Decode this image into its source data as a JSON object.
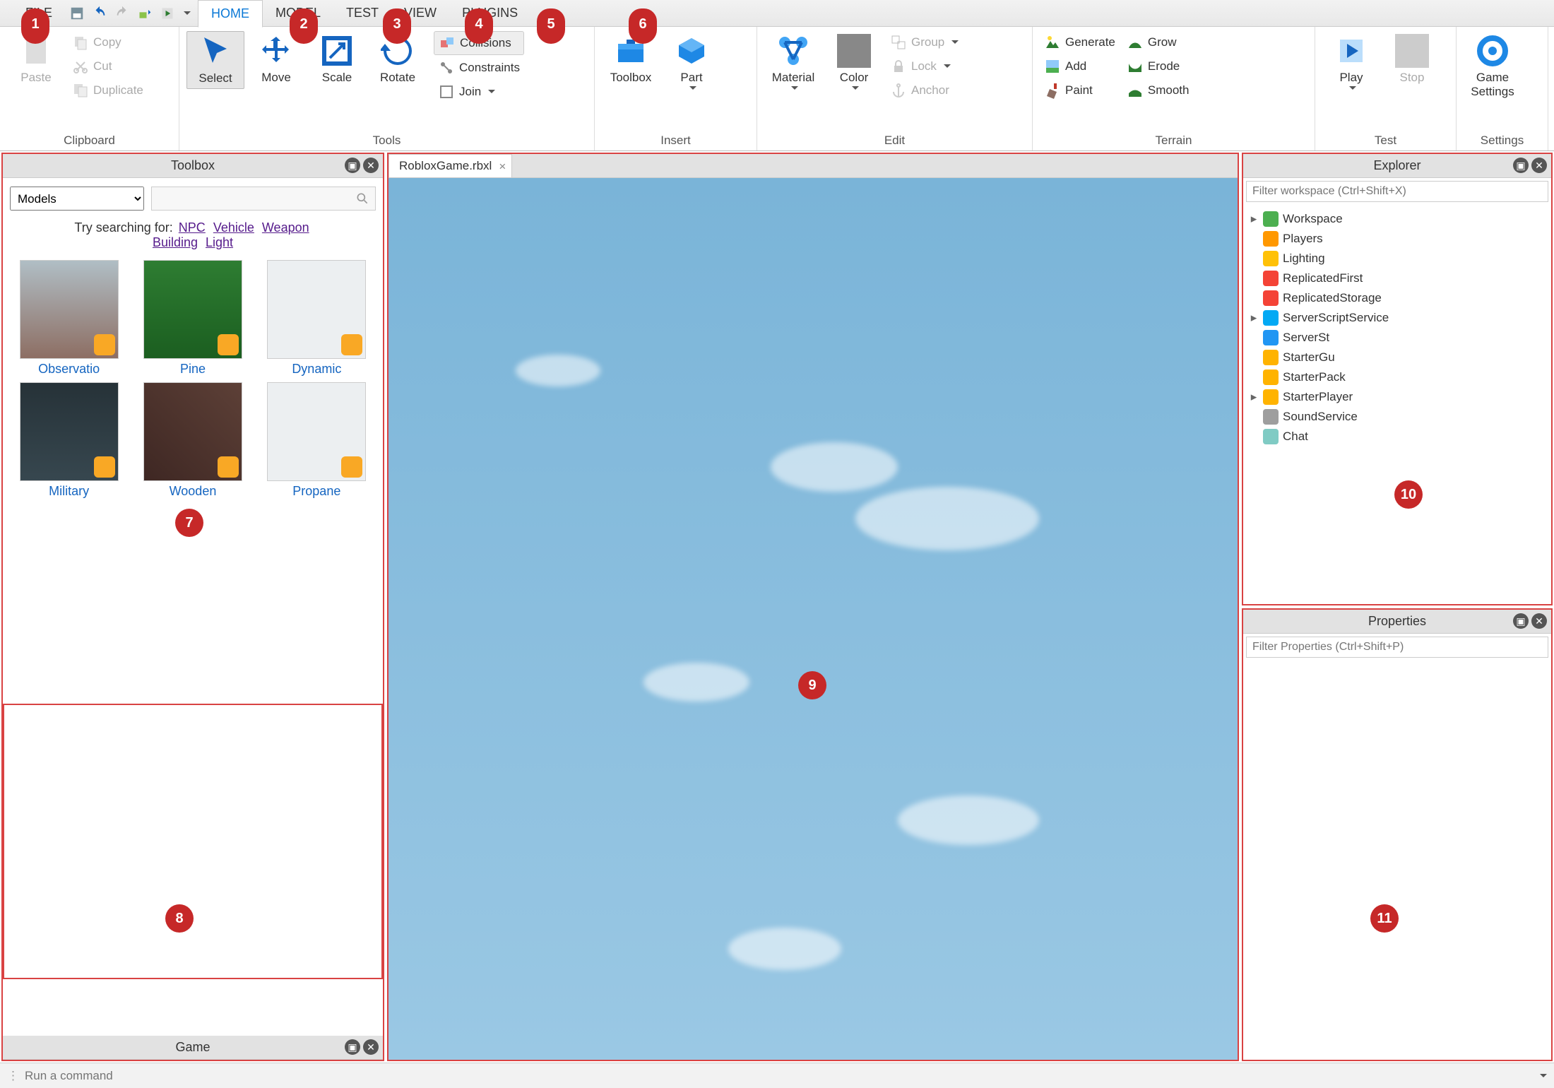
{
  "menu": {
    "file": "FILE",
    "home": "HOME",
    "model": "MODEL",
    "test": "TEST",
    "view": "VIEW",
    "plugins": "PLUGINS"
  },
  "qat": {
    "save": "save-icon",
    "undo": "undo-icon",
    "redo": "redo-icon",
    "export": "export-icon",
    "playtest": "playtest-icon"
  },
  "ribbon": {
    "clipboard": {
      "title": "Clipboard",
      "paste": "Paste",
      "copy": "Copy",
      "cut": "Cut",
      "duplicate": "Duplicate"
    },
    "tools": {
      "title": "Tools",
      "select": "Select",
      "move": "Move",
      "scale": "Scale",
      "rotate": "Rotate",
      "collisions": "Collisions",
      "constraints": "Constraints",
      "join": "Join"
    },
    "insert": {
      "title": "Insert",
      "toolbox": "Toolbox",
      "part": "Part"
    },
    "edit": {
      "title": "Edit",
      "material": "Material",
      "color": "Color",
      "group": "Group",
      "lock": "Lock",
      "anchor": "Anchor"
    },
    "terrain": {
      "title": "Terrain",
      "generate": "Generate",
      "add": "Add",
      "paint": "Paint",
      "grow": "Grow",
      "erode": "Erode",
      "smooth": "Smooth"
    },
    "test": {
      "title": "Test",
      "play": "Play",
      "stop": "Stop"
    },
    "settings": {
      "title": "Settings",
      "game_settings_l1": "Game",
      "game_settings_l2": "Settings"
    }
  },
  "toolbox": {
    "title": "Toolbox",
    "category": "Models",
    "suggest_label": "Try searching for:",
    "suggestions": [
      "NPC",
      "Vehicle",
      "Weapon",
      "Building",
      "Light"
    ],
    "items": [
      {
        "label": "Observatio"
      },
      {
        "label": "Pine"
      },
      {
        "label": "Dynamic"
      },
      {
        "label": "Military"
      },
      {
        "label": "Wooden"
      },
      {
        "label": "Propane"
      }
    ]
  },
  "game_panel": {
    "title": "Game"
  },
  "document": {
    "tab": "RobloxGame.rbxl"
  },
  "explorer": {
    "title": "Explorer",
    "filter_placeholder": "Filter workspace (Ctrl+Shift+X)",
    "items": [
      {
        "label": "Workspace",
        "expandable": true,
        "color": "#4caf50"
      },
      {
        "label": "Players",
        "color": "#ff9800"
      },
      {
        "label": "Lighting",
        "color": "#ffc107"
      },
      {
        "label": "ReplicatedFirst",
        "color": "#f44336"
      },
      {
        "label": "ReplicatedStorage",
        "color": "#f44336"
      },
      {
        "label": "ServerScriptService",
        "expandable": true,
        "color": "#03a9f4"
      },
      {
        "label": "ServerSt",
        "color": "#2196f3"
      },
      {
        "label": "StarterGu",
        "color": "#ffb300"
      },
      {
        "label": "StarterPack",
        "color": "#ffb300"
      },
      {
        "label": "StarterPlayer",
        "expandable": true,
        "color": "#ffb300"
      },
      {
        "label": "SoundService",
        "color": "#9e9e9e"
      },
      {
        "label": "Chat",
        "color": "#80cbc4"
      }
    ]
  },
  "properties": {
    "title": "Properties",
    "filter_placeholder": "Filter Properties (Ctrl+Shift+P)"
  },
  "cmdbar": {
    "placeholder": "Run a command"
  },
  "badges": [
    "1",
    "2",
    "3",
    "4",
    "5",
    "6",
    "7",
    "8",
    "9",
    "10",
    "11"
  ]
}
